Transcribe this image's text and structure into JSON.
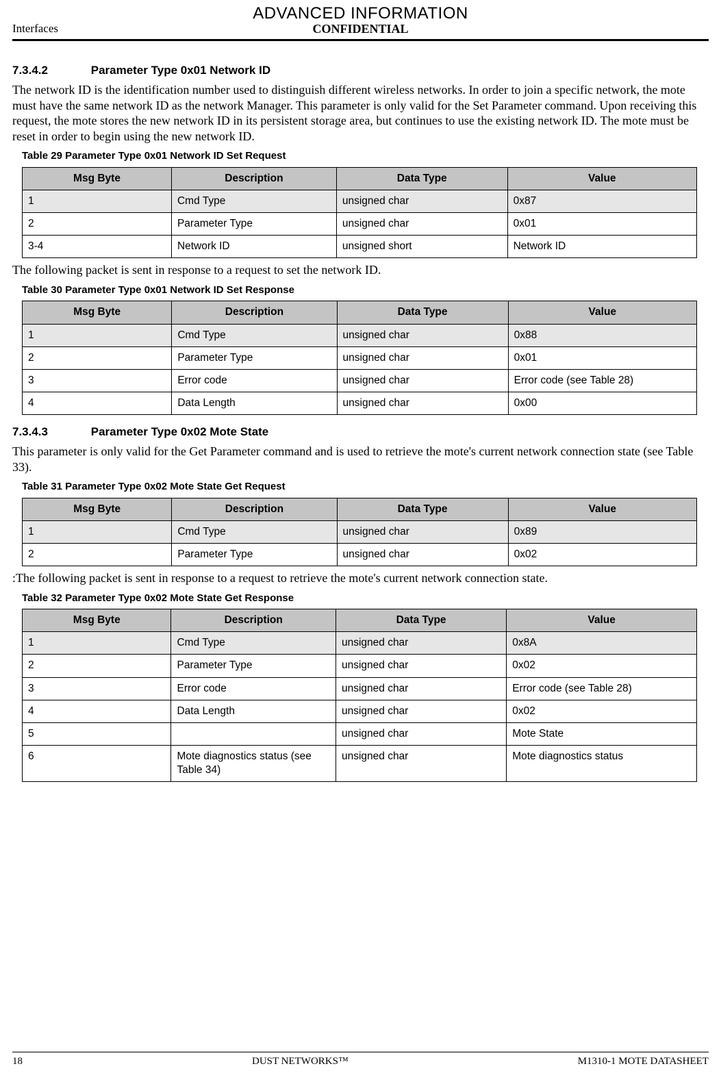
{
  "header": {
    "banner": "ADVANCED INFORMATION",
    "left": "Interfaces",
    "center": "CONFIDENTIAL"
  },
  "section1": {
    "num": "7.3.4.2",
    "title": "Parameter Type 0x01 Network ID",
    "para": "The network ID is the identification number used to distinguish different wireless networks. In order to join a specific network, the mote must have the same network ID as the network Manager. This parameter is only valid for the Set Parameter command. Upon receiving this request, the mote stores the new network ID in its persistent storage area, but continues to use the existing network ID. The mote must be reset in order to begin using the new network ID.",
    "table29_caption": "Table 29    Parameter Type 0x01 Network ID Set Request",
    "table_headers": [
      "Msg Byte",
      "Description",
      "Data Type",
      "Value"
    ],
    "table29_rows": [
      [
        "1",
        "Cmd Type",
        "unsigned char",
        "0x87"
      ],
      [
        "2",
        "Parameter Type",
        "unsigned char",
        "0x01"
      ],
      [
        "3-4",
        "Network ID",
        "unsigned short",
        "Network ID"
      ]
    ],
    "mid_para": "The following packet is sent in response to a request to set the network ID.",
    "table30_caption": "Table 30    Parameter Type 0x01 Network ID Set Response",
    "table30_rows": [
      [
        "1",
        "Cmd Type",
        "unsigned char",
        "0x88"
      ],
      [
        "2",
        "Parameter Type",
        "unsigned char",
        "0x01"
      ],
      [
        "3",
        "Error code",
        "unsigned char",
        "Error code (see Table 28)"
      ],
      [
        "4",
        "Data Length",
        "unsigned char",
        "0x00"
      ]
    ]
  },
  "section2": {
    "num": "7.3.4.3",
    "title": "Parameter Type 0x02 Mote State",
    "para": "This parameter is only valid for the Get Parameter command and is used to retrieve the mote's current network connection state (see Table 33).",
    "table31_caption": "Table 31    Parameter Type 0x02 Mote State Get Request",
    "table31_rows": [
      [
        "1",
        "Cmd Type",
        "unsigned char",
        "0x89"
      ],
      [
        "2",
        "Parameter Type",
        "unsigned char",
        "0x02"
      ]
    ],
    "mid_para": ":The following packet is sent in response to a request to retrieve the mote's current network connection state.",
    "table32_caption": "Table 32    Parameter Type 0x02 Mote State Get Response",
    "table32_rows": [
      [
        "1",
        "Cmd Type",
        "unsigned char",
        "0x8A"
      ],
      [
        "2",
        "Parameter Type",
        "unsigned char",
        "0x02"
      ],
      [
        "3",
        "Error code",
        "unsigned char",
        "Error code (see Table 28)"
      ],
      [
        "4",
        "Data Length",
        "unsigned char",
        "0x02"
      ],
      [
        "5",
        "",
        "unsigned char",
        "Mote State"
      ],
      [
        "6",
        "Mote diagnostics status (see Table 34)",
        "unsigned char",
        "Mote diagnostics status"
      ]
    ]
  },
  "footer": {
    "page": "18",
    "center": "DUST NETWORKS™",
    "right": "M1310-1 MOTE DATASHEET"
  }
}
